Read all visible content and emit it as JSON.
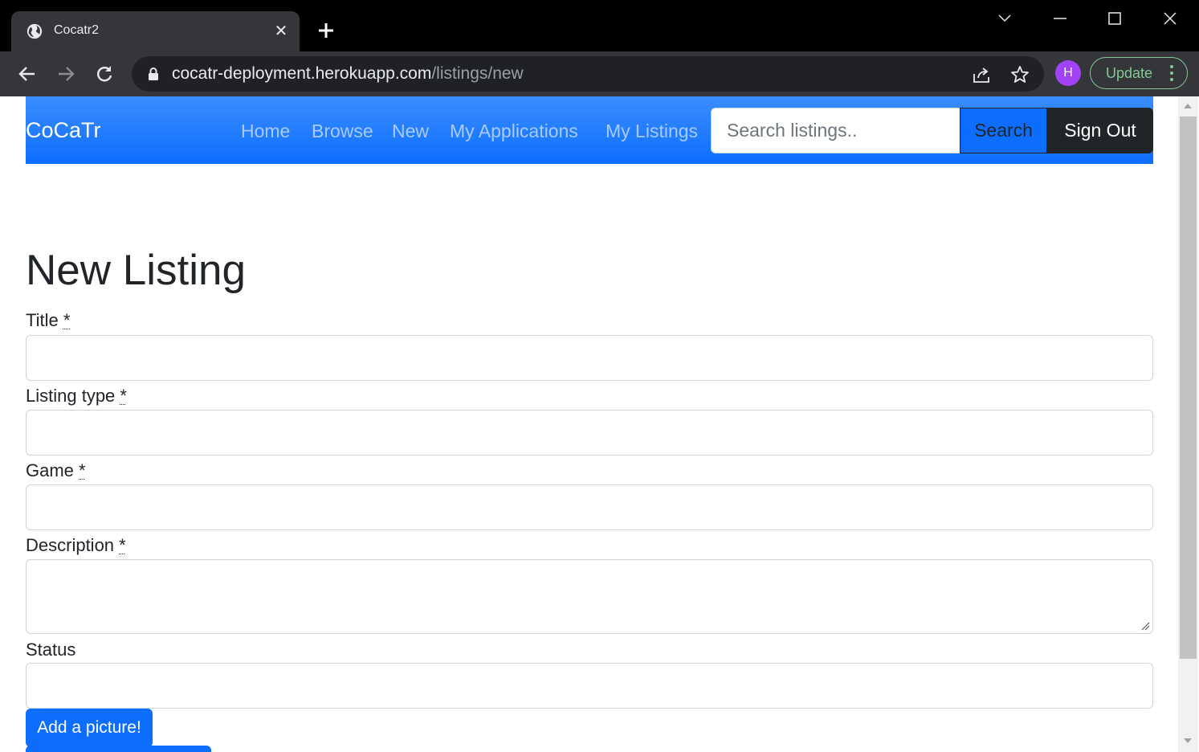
{
  "browser": {
    "tab_title": "Cocatr2",
    "url_host": "cocatr-deployment.herokuapp.com",
    "url_path": "/listings/new",
    "profile_initial": "H",
    "update_label": "Update"
  },
  "navbar": {
    "brand": "CoCaTr",
    "links": [
      "Home",
      "Browse",
      "New",
      "My Applications",
      "My Listings"
    ],
    "search_placeholder": "Search listings..",
    "search_label": "Search",
    "signout_label": "Sign Out"
  },
  "form": {
    "heading": "New Listing",
    "fields": [
      {
        "label": "Title",
        "required": "*",
        "value": ""
      },
      {
        "label": "Listing type",
        "required": "*",
        "value": ""
      },
      {
        "label": "Game",
        "required": "*",
        "value": ""
      },
      {
        "label": "Description",
        "required": "*",
        "value": ""
      },
      {
        "label": "Status",
        "required": "",
        "value": ""
      }
    ],
    "picture_button": "Add a picture!"
  },
  "colors": {
    "primary": "#0d6efd",
    "dark": "#212529",
    "avatar": "#a142f4",
    "update_green": "#81c995"
  }
}
